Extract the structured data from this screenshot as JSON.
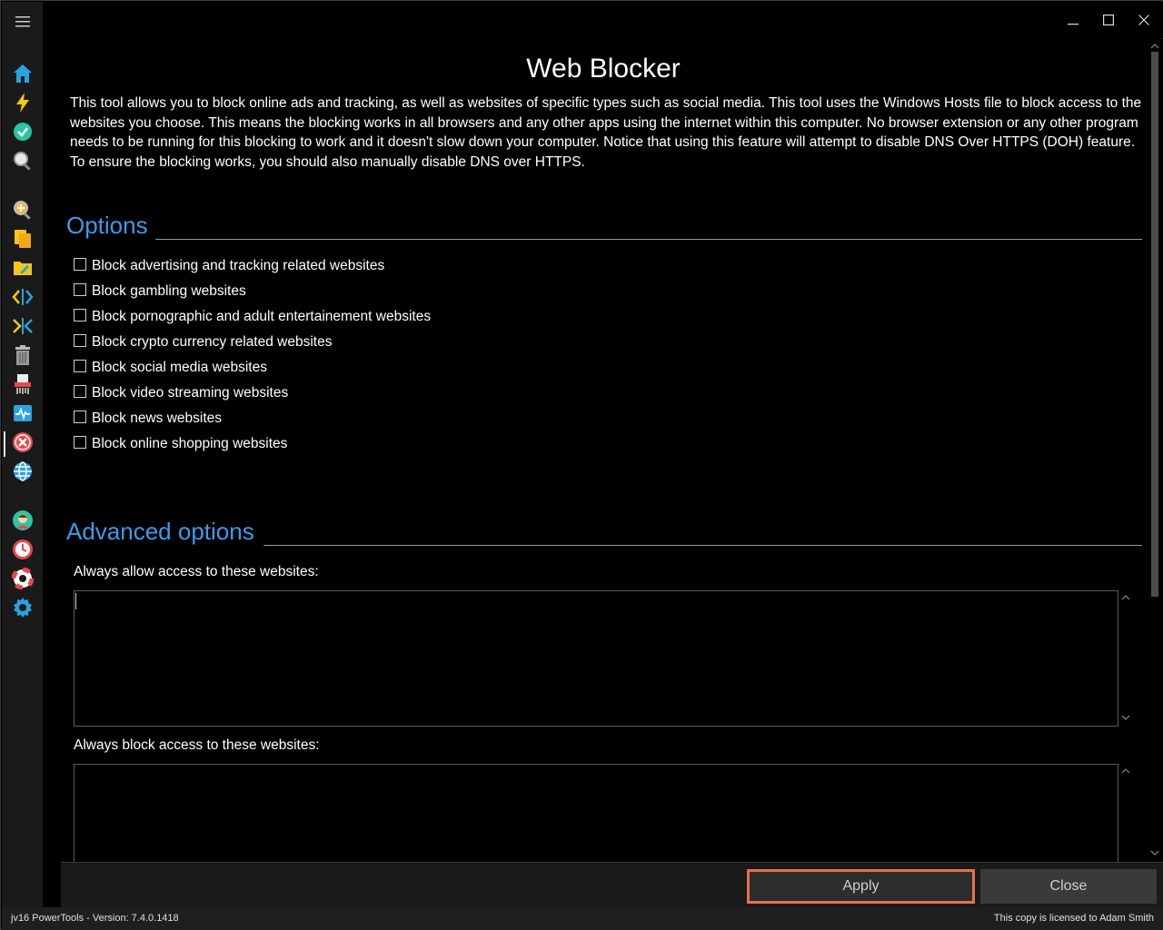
{
  "window": {
    "minimize_icon": "minimize-icon",
    "maximize_icon": "maximize-icon",
    "close_icon": "close-icon"
  },
  "sidebar": {
    "menu_icon": "hamburger-icon",
    "items": [
      {
        "icon": "home-icon",
        "color": "#29a3e0"
      },
      {
        "icon": "lightning-icon",
        "color": "#f5c518"
      },
      {
        "icon": "check-circle-icon",
        "color": "#2bc4a4"
      },
      {
        "icon": "magnifier-icon",
        "color": "#dddddd"
      },
      {
        "icon": "zoom-in-icon",
        "color": "#f0b84a"
      },
      {
        "icon": "files-icon",
        "color": "#f5c518"
      },
      {
        "icon": "folder-edit-icon",
        "color": "#f5c518"
      },
      {
        "icon": "code-arrows-icon",
        "color": "#29a3e0"
      },
      {
        "icon": "merge-arrows-icon",
        "color": "#29a3e0"
      },
      {
        "icon": "trash-icon",
        "color": "#bbbbbb"
      },
      {
        "icon": "shredder-icon",
        "color": "#dddddd"
      },
      {
        "icon": "activity-chart-icon",
        "color": "#29a3e0"
      },
      {
        "icon": "block-x-icon",
        "color": "#e8474a"
      },
      {
        "icon": "globe-icon",
        "color": "#29a3e0"
      },
      {
        "icon": "user-support-icon",
        "color": "#2bc4a4"
      },
      {
        "icon": "clock-icon",
        "color": "#e8474a"
      },
      {
        "icon": "lifebuoy-icon",
        "color": "#e8474a"
      },
      {
        "icon": "gear-icon",
        "color": "#29a3e0"
      }
    ]
  },
  "page": {
    "title": "Web Blocker",
    "description": "This tool allows you to block online ads and tracking, as well as websites of specific types such as social media. This tool uses the Windows Hosts file to block access to the websites you choose. This means the blocking works in all browsers and any other apps using the internet within this computer. No browser extension or any other program needs to be running for this blocking to work and it doesn't slow down your computer. Notice that using this feature will attempt to disable DNS Over HTTPS (DOH) feature. To ensure the blocking works, you should also manually disable DNS over HTTPS."
  },
  "options": {
    "heading": "Options",
    "items": [
      {
        "label": "Block advertising and tracking related websites",
        "checked": false
      },
      {
        "label": "Block gambling websites",
        "checked": false
      },
      {
        "label": "Block pornographic and adult entertainement websites",
        "checked": false
      },
      {
        "label": "Block crypto currency related websites",
        "checked": false
      },
      {
        "label": "Block social media websites",
        "checked": false
      },
      {
        "label": "Block video streaming websites",
        "checked": false
      },
      {
        "label": "Block news websites",
        "checked": false
      },
      {
        "label": "Block online shopping websites",
        "checked": false
      }
    ]
  },
  "advanced": {
    "heading": "Advanced options",
    "allow_label": "Always allow access to these websites:",
    "allow_value": "",
    "block_label": "Always block access to these websites:",
    "block_value": ""
  },
  "buttons": {
    "apply": "Apply",
    "close": "Close"
  },
  "status": {
    "version": "jv16 PowerTools - Version: 7.4.0.1418",
    "license": "This copy is licensed to Adam Smith"
  },
  "colors": {
    "accent": "#3d9be9",
    "apply_border": "#e8704a"
  }
}
